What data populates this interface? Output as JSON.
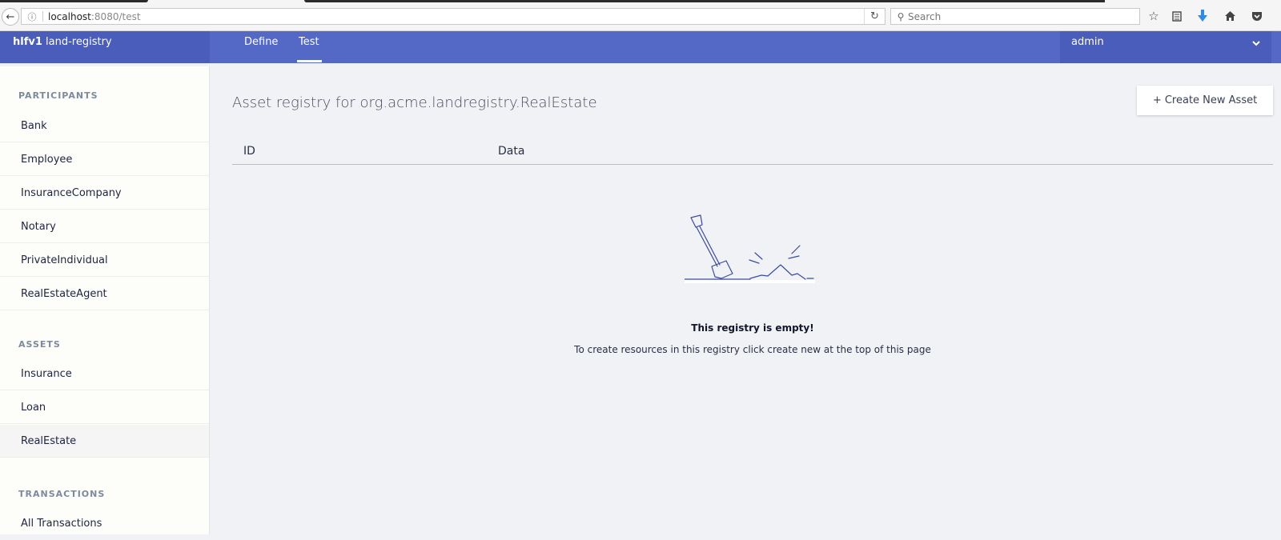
{
  "browser": {
    "url_host": "localhost",
    "url_path": ":8080/test",
    "search_placeholder": "Search"
  },
  "header": {
    "brand_bold": "hlfv1",
    "brand_name": " land-registry",
    "tabs": [
      {
        "label": "Define",
        "active": false
      },
      {
        "label": "Test",
        "active": true
      }
    ],
    "user": "admin"
  },
  "sidebar": {
    "participants_title": "PARTICIPANTS",
    "participants": [
      "Bank",
      "Employee",
      "InsuranceCompany",
      "Notary",
      "PrivateIndividual",
      "RealEstateAgent"
    ],
    "assets_title": "ASSETS",
    "assets": [
      "Insurance",
      "Loan",
      "RealEstate"
    ],
    "selected_asset": "RealEstate",
    "transactions_title": "TRANSACTIONS",
    "transactions": [
      "All Transactions"
    ]
  },
  "main": {
    "title": "Asset registry for org.acme.landregistry.RealEstate",
    "create_button": "+ Create New Asset",
    "columns": [
      "ID",
      "Data"
    ],
    "empty_title": "This registry is empty!",
    "empty_subtitle": "To create resources in this registry click create new at the top of this page"
  },
  "colors": {
    "header": "#5468c6",
    "header_dark": "#4a5dba",
    "sidebar_bg": "#fdfdfa",
    "main_bg": "#f1f2f5"
  }
}
